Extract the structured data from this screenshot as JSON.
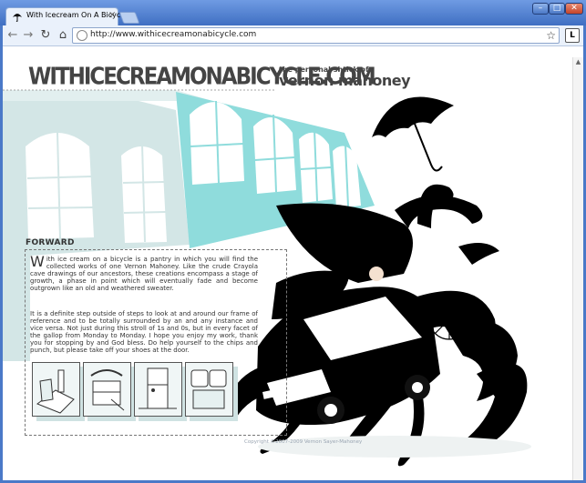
{
  "browser": {
    "tab_title": "With Icecream On A Bicycle",
    "url": "http://www.withicecreamonabicycle.com",
    "icons": {
      "back": "arrow-left-icon",
      "forward": "arrow-right-icon",
      "reload": "reload-icon",
      "home": "home-icon",
      "bookmark": "star-icon",
      "page_menu": "page-menu-icon"
    }
  },
  "site": {
    "title": "WITHICECREAMONABICYCLE.COM",
    "tagline": "the personal shtick of",
    "author": "vernon mahoney",
    "section_heading": "FORWARD",
    "intro_dropcap": "W",
    "intro_rest": "ith ice cream on a bicycle is a pantry in which you will find the collected works of one Vernon Mahoney. Like the crude Crayola cave drawings of our ancestors, these creations encompass a stage of growth, a phase in point which will eventually fade and become outgrown like an old and weathered sweater.",
    "para2": "It is a definite step outside of steps to look at and around our frame of reference and to be totally surrounded by an and any instance and vice versa. Not just during this stroll of 1s and 0s, but in every facet of the gallop from Monday to Monday. I hope you enjoy my work, thank you for stopping by and God bless. Do help yourself to the chips and punch, but please take off your shoes at the door.",
    "copyright": "Copyright ©2007-2009 Vernon Sayer-Mahoney"
  },
  "colors": {
    "accent_teal": "#8fdcdc",
    "bg_teal": "#cfe3e3",
    "ink": "#000000",
    "text": "#333333"
  }
}
